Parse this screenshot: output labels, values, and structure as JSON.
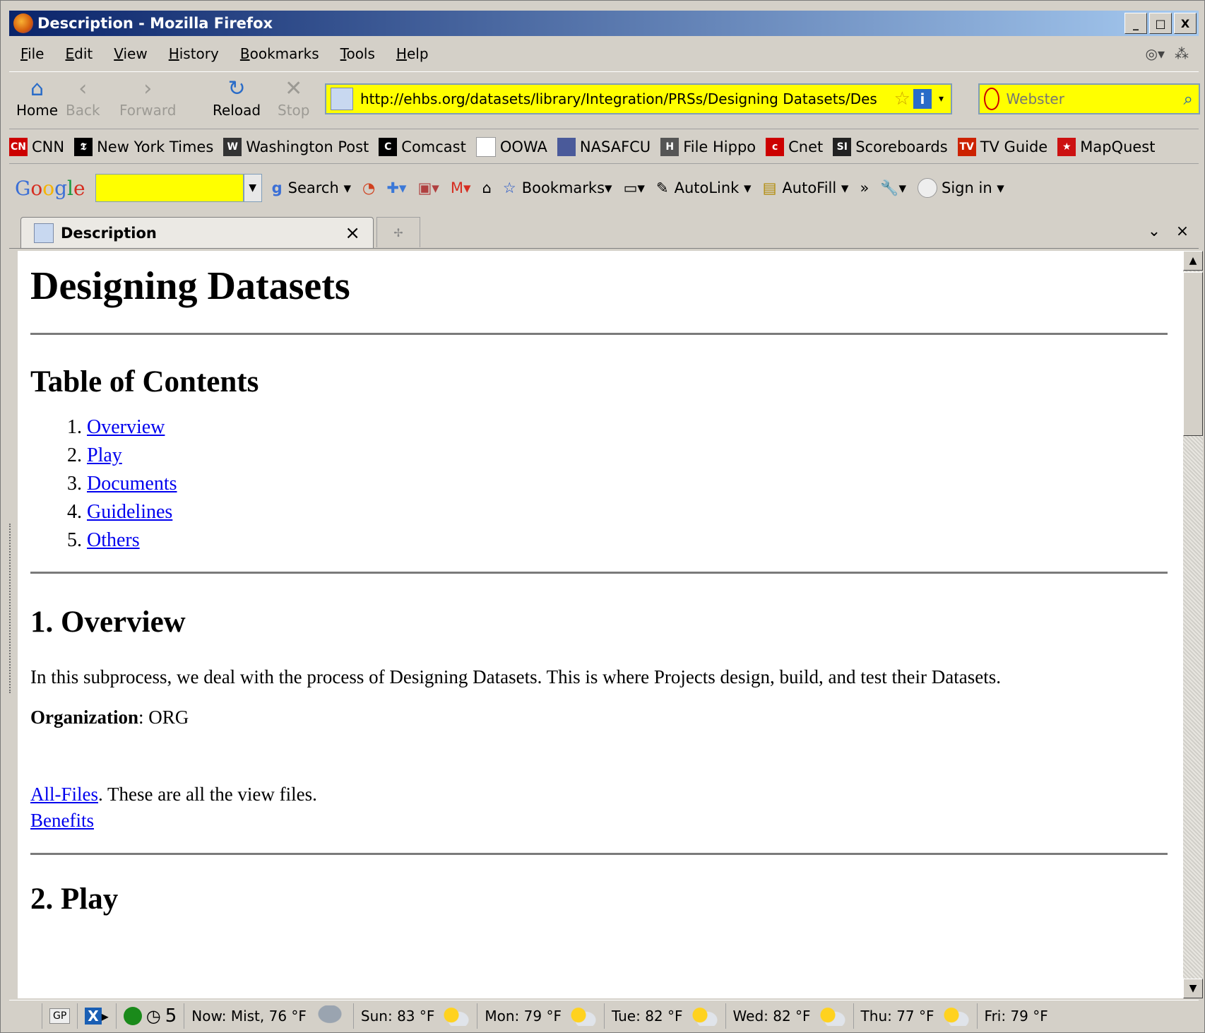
{
  "window": {
    "title": "Description - Mozilla Firefox",
    "controls": {
      "minimize": "_",
      "maximize": "□",
      "close": "X"
    }
  },
  "menu": [
    "File",
    "Edit",
    "View",
    "History",
    "Bookmarks",
    "Tools",
    "Help"
  ],
  "nav": {
    "home": "Home",
    "back": "Back",
    "forward": "Forward",
    "reload": "Reload",
    "stop": "Stop",
    "url": "http://ehbs.org/datasets/library/Integration/PRSs/Designing Datasets/Des",
    "search_placeholder": "Webster"
  },
  "bookmarks": [
    {
      "label": "CNN",
      "icon": "cnn-icon",
      "color": "#cc0000",
      "glyph": "CN"
    },
    {
      "label": "New York Times",
      "icon": "nyt-icon",
      "color": "#000000",
      "glyph": "𝕿"
    },
    {
      "label": "Washington Post",
      "icon": "wapo-icon",
      "color": "#333333",
      "glyph": "W"
    },
    {
      "label": "Comcast",
      "icon": "comcast-icon",
      "color": "#000000",
      "glyph": "C"
    },
    {
      "label": "OOWA",
      "icon": "page-icon",
      "color": "#ffffff",
      "glyph": ""
    },
    {
      "label": "NASAFCU",
      "icon": "nasafcu-icon",
      "color": "#4a5a9a",
      "glyph": ""
    },
    {
      "label": "File Hippo",
      "icon": "filehippo-icon",
      "color": "#555555",
      "glyph": "H"
    },
    {
      "label": "Cnet",
      "icon": "cnet-icon",
      "color": "#cc0000",
      "glyph": "c"
    },
    {
      "label": "Scoreboards",
      "icon": "si-icon",
      "color": "#222222",
      "glyph": "SI"
    },
    {
      "label": "TV Guide",
      "icon": "tvguide-icon",
      "color": "#cc2200",
      "glyph": "TV"
    },
    {
      "label": "MapQuest",
      "icon": "mapquest-icon",
      "color": "#cc1111",
      "glyph": "★"
    }
  ],
  "google_toolbar": {
    "logo": "Google",
    "search": "Search",
    "bookmarks": "Bookmarks",
    "autolink": "AutoLink",
    "autofill": "AutoFill",
    "more": "»",
    "signin": "Sign in"
  },
  "tab": {
    "title": "Description"
  },
  "page": {
    "title": "Designing Datasets",
    "toc_heading": "Table of Contents",
    "toc": [
      "Overview",
      "Play",
      "Documents",
      "Guidelines",
      "Others"
    ],
    "section1_heading": "1. Overview",
    "section1_text": "In this subprocess, we deal with the process of Designing Datasets. This is where Projects design, build, and test their Datasets.",
    "org_label": "Organization",
    "org_value": ": ORG",
    "all_files_link": "All-Files",
    "all_files_text": ". These are all the view files.",
    "benefits_link": "Benefits",
    "section2_heading": "2. Play"
  },
  "status": {
    "gp": "GP",
    "count": "5",
    "now": "Now: Mist, 76 °F",
    "forecast": [
      "Sun: 83 °F",
      "Mon: 79 °F",
      "Tue: 82 °F",
      "Wed: 82 °F",
      "Thu: 77 °F",
      "Fri: 79 °F"
    ]
  }
}
